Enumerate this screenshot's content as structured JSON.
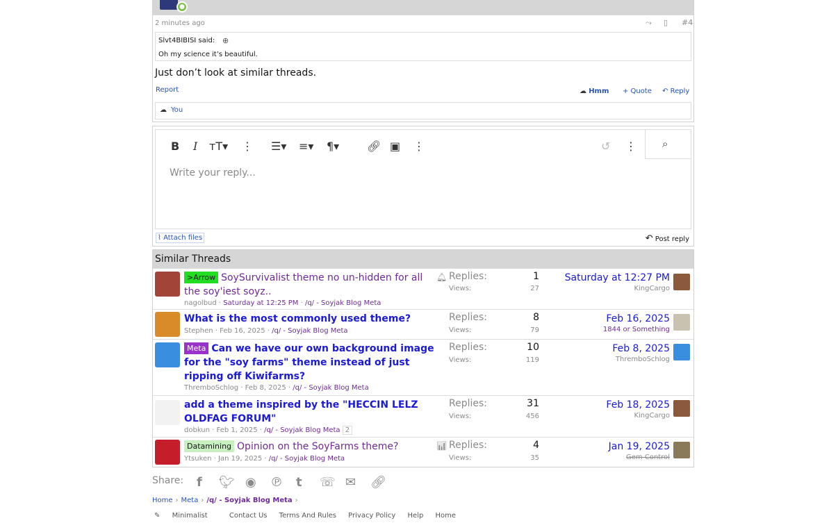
{
  "post": {
    "time": "2 minutes ago",
    "post_number": "#4",
    "quote_author": "Slvt4BIBISI said:",
    "quote_text": "Oh my science it’s beautiful.",
    "body": "Just don’t look at similar threads.",
    "report_label": "Report",
    "react_label": "Hmm",
    "quote_label": "+ Quote",
    "reply_label": "Reply",
    "reactions_by": "You"
  },
  "editor": {
    "placeholder": "Write your reply...",
    "attach_label": "Attach files",
    "post_reply_label": "Post reply"
  },
  "similar": {
    "title": "Similar Threads",
    "replies_label": "Replies:",
    "views_label": "Views:",
    "threads": [
      {
        "tag": ">Arrow",
        "tag_bg": "#22dd22",
        "tag_color": "#141414",
        "title": "SoySurvivalist theme no un-hidden for all the soy'iest soyz..",
        "author": "nagolbud",
        "date": "Saturday at 12:25 PM",
        "forum": "/q/ - Soyjak Blog Meta",
        "replies": "1",
        "views": "27",
        "last_date": "Saturday at 12:27 PM",
        "last_user": "KingCargo"
      },
      {
        "tag": "",
        "title": "What is the most commonly used theme?",
        "author": "Stephen",
        "date": "Feb 16, 2025",
        "forum": "/q/ - Soyjak Blog Meta",
        "replies": "8",
        "views": "79",
        "last_date": "Feb 16, 2025",
        "last_user": "1844 or Something"
      },
      {
        "tag": "Meta",
        "tag_bg": "#9933cc",
        "tag_color": "#ffffff",
        "title": "Can we have our own background image for the \"soy farms\" theme instead of just ripping off Kiwifarms?",
        "author": "ThremboSchlog",
        "date": "Feb 8, 2025",
        "forum": "/q/ - Soyjak Blog Meta",
        "replies": "10",
        "views": "119",
        "last_date": "Feb 8, 2025",
        "last_user": "ThremboSchlog"
      },
      {
        "tag": "",
        "title": "add a theme inspired by the \"HECCIN LELZ OLDFAG FORUM\"",
        "author": "dobkun",
        "date": "Feb 1, 2025",
        "forum": "/q/ - Soyjak Blog Meta",
        "page": "2",
        "replies": "31",
        "views": "456",
        "last_date": "Feb 18, 2025",
        "last_user": "KingCargo"
      },
      {
        "tag": "Datamining",
        "tag_bg": "#c8f0c0",
        "tag_color": "#141414",
        "title": "Opinion on the SoyFarms theme?",
        "author": "Ytsuken",
        "date": "Jan 19, 2025",
        "forum": "/q/ - Soyjak Blog Meta",
        "replies": "4",
        "views": "35",
        "last_date": "Jan 19, 2025",
        "last_user": "Gem Control"
      }
    ]
  },
  "share": {
    "label": "Share:"
  },
  "breadcrumb": {
    "home": "Home",
    "meta": "Meta",
    "forum": "/q/ - Soyjak Blog Meta"
  },
  "footer": {
    "style": "Minimalist",
    "links": [
      "Contact Us",
      "Terms And Rules",
      "Privacy Policy",
      "Help",
      "Home"
    ]
  }
}
